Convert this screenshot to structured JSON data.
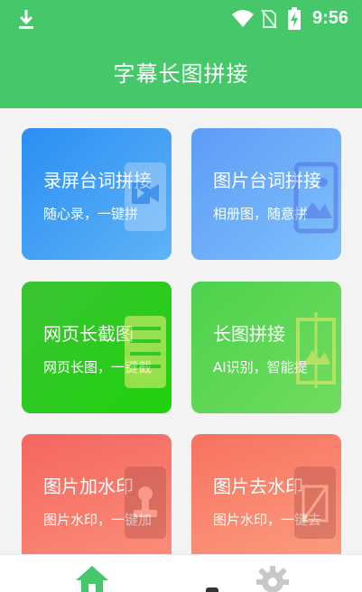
{
  "status_bar": {
    "time": "9:56",
    "icons": [
      "download-icon",
      "wifi-icon",
      "no-sim-icon",
      "battery-charging-icon"
    ]
  },
  "header": {
    "title": "字幕长图拼接"
  },
  "cards": [
    {
      "title": "录屏台词拼接",
      "subtitle": "随心录，一键拼",
      "icon": "video-icon"
    },
    {
      "title": "图片台词拼接",
      "subtitle": "相册图，随意拼",
      "icon": "image-icon"
    },
    {
      "title": "网页长截图",
      "subtitle": "网页长图，一键截",
      "icon": "webpage-icon"
    },
    {
      "title": "长图拼接",
      "subtitle": "AI识别，智能提",
      "icon": "stitch-image-icon"
    },
    {
      "title": "图片加水印",
      "subtitle": "图片水印，一键加",
      "icon": "stamp-icon"
    },
    {
      "title": "图片去水印",
      "subtitle": "图片水印，一键去",
      "icon": "remove-watermark-icon"
    }
  ],
  "bottom_nav": {
    "items": [
      "home-icon",
      "settings-icon"
    ],
    "colors": {
      "active": "#46c86a",
      "inactive": "#bdbdbd"
    }
  },
  "colors": {
    "primary": "#46c86a"
  }
}
